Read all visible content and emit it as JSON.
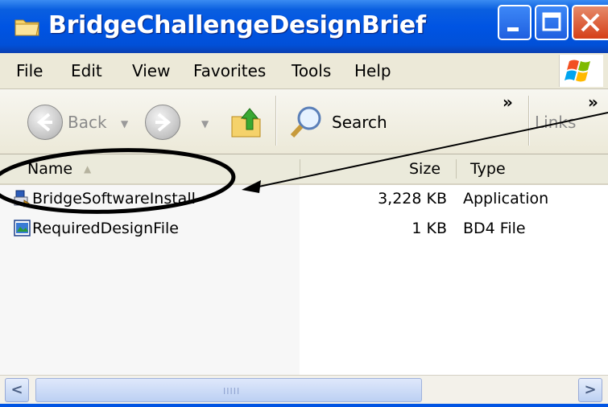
{
  "window": {
    "title": "BridgeChallengeDesignBrief"
  },
  "menu": {
    "items": [
      {
        "label": "File"
      },
      {
        "label": "Edit"
      },
      {
        "label": "View"
      },
      {
        "label": "Favorites"
      },
      {
        "label": "Tools"
      },
      {
        "label": "Help"
      }
    ]
  },
  "toolbar": {
    "back_label": "Back",
    "search_label": "Search",
    "links_label": "Links",
    "overflow": "»"
  },
  "columns": {
    "name": "Name",
    "size": "Size",
    "type": "Type",
    "sort_indicator": "▲"
  },
  "files": [
    {
      "name": "BridgeSoftwareInstall",
      "size": "3,228 KB",
      "type": "Application",
      "icon": "installer-icon"
    },
    {
      "name": "RequiredDesignFile",
      "size": "1 KB",
      "type": "BD4 File",
      "icon": "document-icon"
    }
  ],
  "scrollbar": {
    "left_arrow": "<",
    "right_arrow": ">",
    "grip": "IIIII"
  },
  "colors": {
    "titlebar": "#0054e3",
    "close_button": "#d54018",
    "annotation": "#000000"
  }
}
